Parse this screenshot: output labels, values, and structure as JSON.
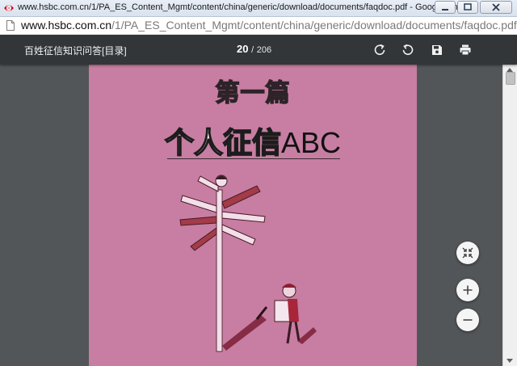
{
  "window": {
    "title": "www.hsbc.com.cn/1/PA_ES_Content_Mgmt/content/china/generic/download/documents/faqdoc.pdf - Google Chrome",
    "buttons": [
      "minimize-icon",
      "maximize-icon",
      "close-icon"
    ]
  },
  "address_bar": {
    "domain": "www.hsbc.com.cn",
    "path": "/1/PA_ES_Content_Mgmt/content/china/generic/download/documents/faqdoc.pdf"
  },
  "pdf_toolbar": {
    "doc_title": "百姓征信知识问答[目录]",
    "current_page": "20",
    "separator": "/",
    "total_pages": "206",
    "icons": [
      "rotate-clockwise-icon",
      "rotate-counterclockwise-icon",
      "save-icon",
      "print-icon"
    ]
  },
  "page_content": {
    "chapter": "第一篇",
    "heading_cn": "个人征信",
    "heading_en": "ABC"
  },
  "zoom_controls": [
    "fit-to-page-icon",
    "zoom-in-icon",
    "zoom-out-icon"
  ],
  "colors": {
    "toolbar_bg": "#323639",
    "viewer_bg": "#525659",
    "page_bg": "#c77ea2"
  }
}
